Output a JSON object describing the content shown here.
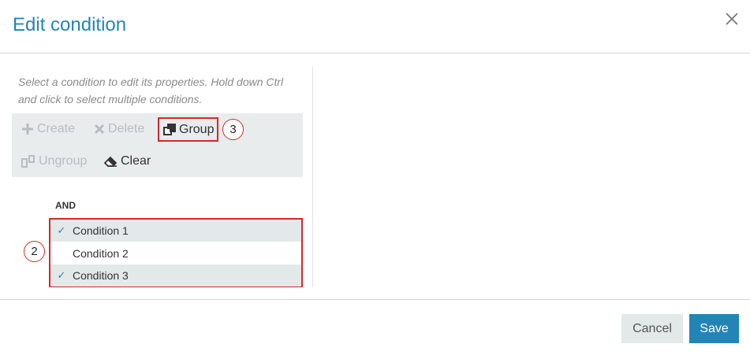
{
  "dialog": {
    "title": "Edit condition",
    "hint": "Select a condition to edit its properties. Hold down Ctrl and click to select multiple conditions."
  },
  "toolbar": {
    "create_label": "Create",
    "delete_label": "Delete",
    "group_label": "Group",
    "ungroup_label": "Ungroup",
    "clear_label": "Clear"
  },
  "callouts": {
    "group": "3",
    "conditions": "2"
  },
  "conditions": {
    "operator": "AND",
    "items": [
      {
        "label": "Condition 1",
        "selected": true,
        "check": "✓"
      },
      {
        "label": "Condition 2",
        "selected": false,
        "check": ""
      },
      {
        "label": "Condition 3",
        "selected": true,
        "check": "✓"
      }
    ]
  },
  "footer": {
    "cancel_label": "Cancel",
    "save_label": "Save"
  },
  "colors": {
    "accent": "#2385b7",
    "annotation_red": "#d62828",
    "toolbar_bg": "#e8ecec",
    "disabled_text": "#b8bcbf"
  }
}
